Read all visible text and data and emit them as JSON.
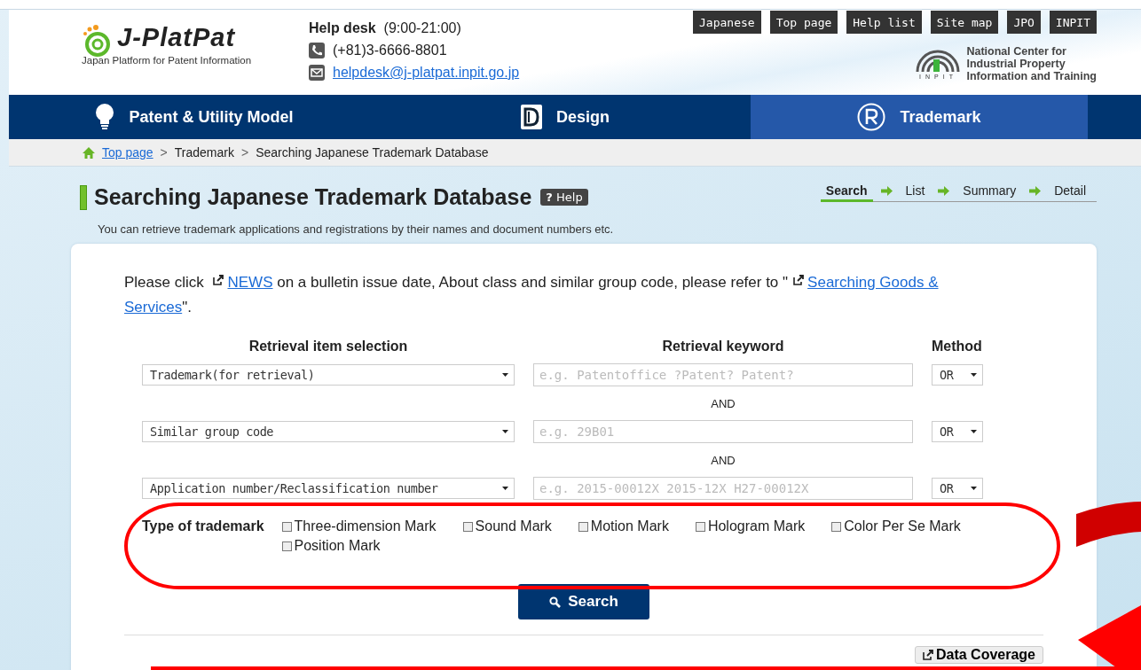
{
  "header": {
    "logo": {
      "name": "J-PlatPat",
      "tagline": "Japan Platform for Patent Information"
    },
    "helpdesk": {
      "label": "Help desk",
      "hours": "(9:00-21:00)",
      "phone": "(+81)3-6666-8801",
      "email": "helpdesk@j-platpat.inpit.go.jp"
    },
    "top_links": [
      "Japanese",
      "Top page",
      "Help list",
      "Site map",
      "JPO",
      "INPIT"
    ],
    "org": {
      "abbr": "INPIT",
      "lines": [
        "National Center for",
        "Industrial Property",
        "Information and Training"
      ]
    }
  },
  "nav_tabs": [
    {
      "label": "Patent & Utility Model",
      "kind": "bulb",
      "selected": false
    },
    {
      "label": "Design",
      "kind": "design",
      "selected": false
    },
    {
      "label": "Trademark",
      "kind": "registered",
      "selected": true
    }
  ],
  "breadcrumb": [
    {
      "label": "Top page",
      "kind": "link"
    },
    {
      "label": ">",
      "kind": "sep"
    },
    {
      "label": "Trademark",
      "kind": "text"
    },
    {
      "label": ">",
      "kind": "sep"
    },
    {
      "label": "Searching Japanese Trademark Database",
      "kind": "text"
    }
  ],
  "page": {
    "title": "Searching Japanese Trademark Database",
    "help_icon": "?",
    "help": "Help",
    "subtitle": "You can retrieve trademark applications and registrations by their names and document numbers etc.",
    "steps": [
      {
        "label": "Search",
        "selected": true
      },
      {
        "label": "List",
        "selected": false
      },
      {
        "label": "Summary",
        "selected": false
      },
      {
        "label": "Detail",
        "selected": false
      }
    ]
  },
  "notice": {
    "parts": [
      "Please click ",
      "NEWS",
      " on a bulletin issue date, About class and similar group code, please refer to \"",
      "Searching Goods &",
      "Services",
      "\"."
    ]
  },
  "form": {
    "columns": [
      "Retrieval item selection",
      "Retrieval keyword",
      "Method"
    ],
    "rows": [
      {
        "item": "Trademark(for retrieval)",
        "placeholder": "e.g. Patentoffice ?Patent? Patent?",
        "method": "OR"
      },
      {
        "item": "Similar group code",
        "placeholder": "e.g. 29B01",
        "method": "OR"
      },
      {
        "item": "Application number/Reclassification number",
        "placeholder": "e.g. 2015-00012X 2015-12X H27-00012X",
        "method": "OR"
      }
    ],
    "connectors": [
      "AND",
      "AND"
    ],
    "type_label": "Type of trademark",
    "types": [
      {
        "label": "Three-dimension Mark",
        "checked": false
      },
      {
        "label": "Sound Mark",
        "checked": false
      },
      {
        "label": "Motion Mark",
        "checked": false
      },
      {
        "label": "Hologram Mark",
        "checked": false
      },
      {
        "label": "Color Per Se Mark",
        "checked": false
      },
      {
        "label": "Position Mark",
        "checked": false
      }
    ],
    "search_button": "Search",
    "coverage_button": "Data Coverage"
  }
}
